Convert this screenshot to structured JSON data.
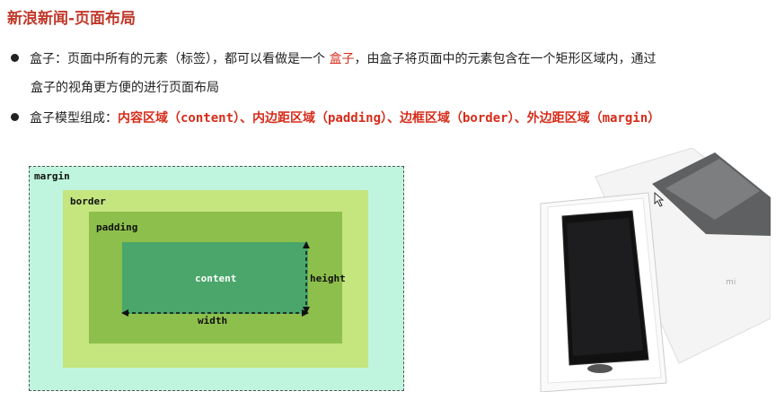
{
  "page": {
    "title": "新浪新闻-页面布局"
  },
  "bullets": {
    "b1_line1_pre": "盒子：页面中所有的元素（标签），都可以看做是一个 ",
    "b1_highlight": "盒子",
    "b1_line1_post": "，由盒子将页面中的元素包含在一个矩形区域内，通过",
    "b1_line2": "盒子的视角更方便的进行页面布局",
    "b2_pre": "盒子模型组成：",
    "b2_items": "内容区域（content）、内边距区域（padding）、边框区域（border）、外边距区域（margin）"
  },
  "diagram": {
    "margin_label": "margin",
    "border_label": "border",
    "padding_label": "padding",
    "content_label": "content",
    "height_label": "height",
    "width_label": "width",
    "colors": {
      "margin": "#bff5de",
      "border": "#c5e57f",
      "padding": "#8dbf4c",
      "content": "#4aa66a"
    }
  },
  "photo": {
    "brand_mark": "mi",
    "desc_icon": "phone-in-box-image"
  },
  "colors": {
    "accent": "#c0392b"
  }
}
